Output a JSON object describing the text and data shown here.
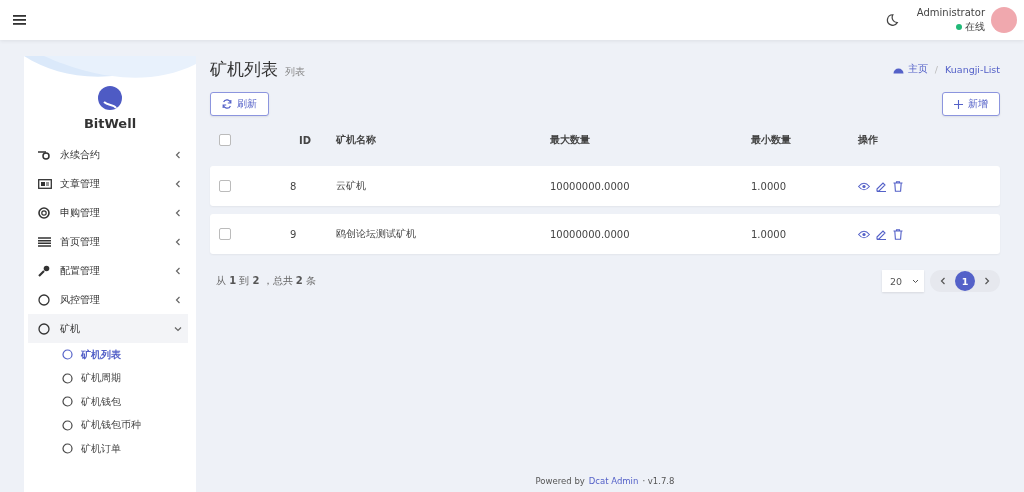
{
  "header": {
    "user": {
      "name": "Administrator",
      "status": "在线"
    }
  },
  "sidebar": {
    "brand": "BitWell",
    "items": [
      {
        "label": "永续合约",
        "expanded": false
      },
      {
        "label": "文章管理",
        "expanded": false
      },
      {
        "label": "申购管理",
        "expanded": false
      },
      {
        "label": "首页管理",
        "expanded": false
      },
      {
        "label": "配置管理",
        "expanded": false
      },
      {
        "label": "风控管理",
        "expanded": false
      },
      {
        "label": "矿机",
        "expanded": true,
        "children": [
          {
            "label": "矿机列表",
            "selected": true
          },
          {
            "label": "矿机周期",
            "selected": false
          },
          {
            "label": "矿机钱包",
            "selected": false
          },
          {
            "label": "矿机钱包币种",
            "selected": false
          },
          {
            "label": "矿机订单",
            "selected": false
          }
        ]
      }
    ]
  },
  "page": {
    "title": "矿机列表",
    "subtitle": "列表",
    "breadcrumb": [
      "主页",
      "Kuangji-List"
    ],
    "breadcrumb_separator": "/"
  },
  "toolbar": {
    "refresh": "刷新",
    "create": "新增"
  },
  "table": {
    "all_checked": false,
    "columns": [
      "ID",
      "矿机名称",
      "最大数量",
      "最小数量",
      "操作"
    ],
    "rows": [
      {
        "checked": false,
        "cells": [
          "8",
          "云矿机",
          "10000000.0000",
          "1.0000"
        ]
      },
      {
        "checked": false,
        "cells": [
          "9",
          "鸥创论坛测试矿机",
          "10000000.0000",
          "1.0000"
        ]
      }
    ]
  },
  "summary": {
    "prefix": "从",
    "from": "1",
    "to_word": "到",
    "to": "2",
    "total_word": "，总共",
    "total": "2",
    "suffix": "条"
  },
  "pagination": {
    "per_page": "20",
    "pages": [
      {
        "label": "1",
        "selected": true
      }
    ]
  },
  "footer": {
    "text": "Powered by",
    "link": "Dcat Admin",
    "version": "· v1.7.8"
  }
}
